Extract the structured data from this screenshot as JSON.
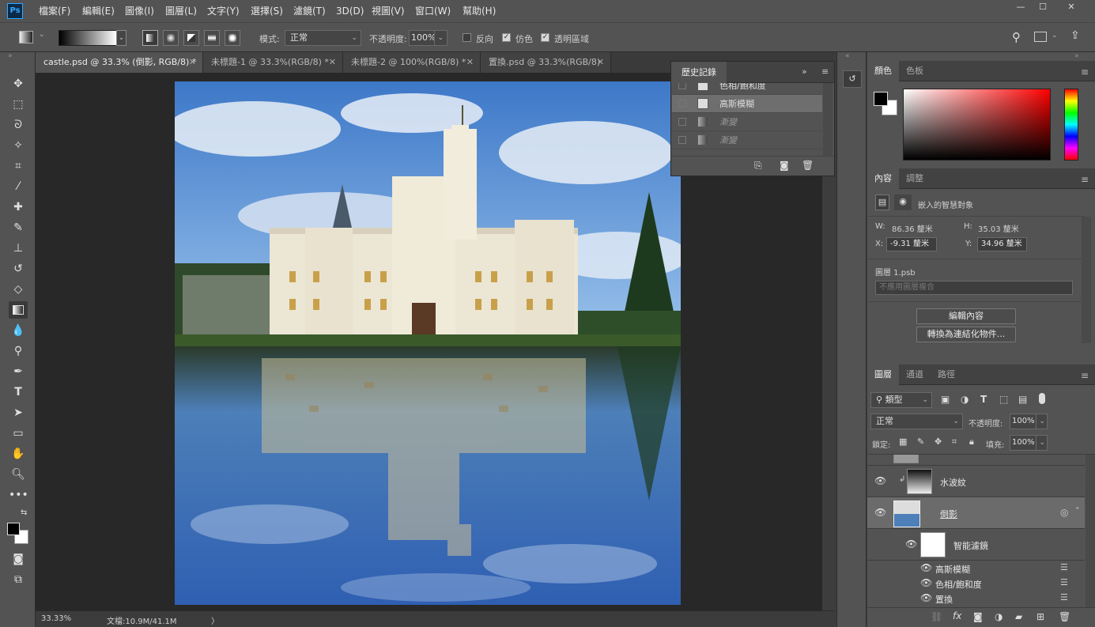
{
  "menubar": {
    "logo": "Ps",
    "items": [
      "檔案(F)",
      "編輯(E)",
      "圖像(I)",
      "圖層(L)",
      "文字(Y)",
      "選擇(S)",
      "濾鏡(T)",
      "3D(D)",
      "視圖(V)",
      "窗口(W)",
      "幫助(H)"
    ],
    "min": "—",
    "max": "☐",
    "close": "✕"
  },
  "options": {
    "mode_label": "模式:",
    "mode_value": "正常",
    "opacity_label": "不透明度:",
    "opacity_value": "100%",
    "reverse_label": "反向",
    "dither_label": "仿色",
    "transparency_label": "透明區域"
  },
  "tabs": [
    {
      "label": "castle.psd @ 33.3% (倒影, RGB/8) *"
    },
    {
      "label": "未標題-1 @ 33.3%(RGB/8) *"
    },
    {
      "label": "未標題-2 @ 100%(RGB/8) *"
    },
    {
      "label": "置換.psd @ 33.3%(RGB/8)"
    }
  ],
  "status": {
    "zoom": "33.33%",
    "doc": "文檔:10.9M/41.1M",
    "arrow": "〉"
  },
  "history": {
    "title": "歷史記錄",
    "rows": [
      "色相/飽和度",
      "高斯模糊",
      "漸變",
      "漸變"
    ]
  },
  "color_panel": {
    "tab1": "顏色",
    "tab2": "色板"
  },
  "properties": {
    "tab1": "內容",
    "tab2": "調整",
    "type_label": "嵌入的智慧對象",
    "w_label": "W:",
    "w_value": "86.36 釐米",
    "h_label": "H:",
    "h_value": "35.03 釐米",
    "x_label": "X:",
    "x_value": "-9.31 釐米",
    "y_label": "Y:",
    "y_value": "34.96 釐米",
    "file": "圖層 1.psb",
    "comp": "不應用圖層複合",
    "edit_btn": "編輯內容",
    "convert_btn": "轉換為連結化物件..."
  },
  "layers": {
    "tab1": "圖層",
    "tab2": "通道",
    "tab3": "路徑",
    "filter_kind": "類型",
    "blend": "正常",
    "opacity_label": "不透明度:",
    "opacity_value": "100%",
    "lock_label": "鎖定:",
    "fill_label": "填充:",
    "fill_value": "100%",
    "items": {
      "ripple": "水波紋",
      "reflection": "倒影",
      "smart_filters": "智能濾鏡",
      "gaussian": "高斯模糊",
      "hue": "色相/飽和度",
      "displace": "置換"
    }
  }
}
